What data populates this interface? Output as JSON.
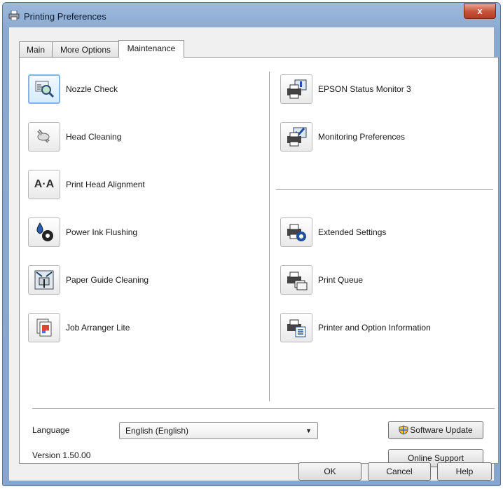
{
  "window": {
    "title": "Printing Preferences",
    "close_glyph": "x"
  },
  "tabs": [
    {
      "label": "Main"
    },
    {
      "label": "More Options"
    },
    {
      "label": "Maintenance"
    }
  ],
  "active_tab": "Maintenance",
  "left_items": [
    {
      "label": "Nozzle Check",
      "icon": "nozzle-check-icon"
    },
    {
      "label": "Head Cleaning",
      "icon": "head-cleaning-icon"
    },
    {
      "label": "Print Head Alignment",
      "icon": "print-head-alignment-icon",
      "icon_text": "A·A"
    },
    {
      "label": "Power Ink Flushing",
      "icon": "power-ink-flushing-icon"
    },
    {
      "label": "Paper Guide Cleaning",
      "icon": "paper-guide-cleaning-icon"
    },
    {
      "label": "Job Arranger Lite",
      "icon": "job-arranger-icon"
    }
  ],
  "right_items": [
    {
      "label": "EPSON Status Monitor 3",
      "icon": "status-monitor-icon"
    },
    {
      "label": "Monitoring Preferences",
      "icon": "monitoring-preferences-icon"
    },
    {
      "label": "Extended Settings",
      "icon": "extended-settings-icon"
    },
    {
      "label": "Print Queue",
      "icon": "print-queue-icon"
    },
    {
      "label": "Printer and Option Information",
      "icon": "printer-info-icon"
    }
  ],
  "language": {
    "label": "Language",
    "value": "English (English)"
  },
  "software_update_label": "Software Update",
  "version": "Version 1.50.00",
  "online_support_label": "Online Support",
  "buttons": {
    "ok": "OK",
    "cancel": "Cancel",
    "help": "Help"
  },
  "colors": {
    "title_bar": "#8aaad2",
    "close_button": "#c7553d",
    "focus_border": "#7fb5e8"
  }
}
